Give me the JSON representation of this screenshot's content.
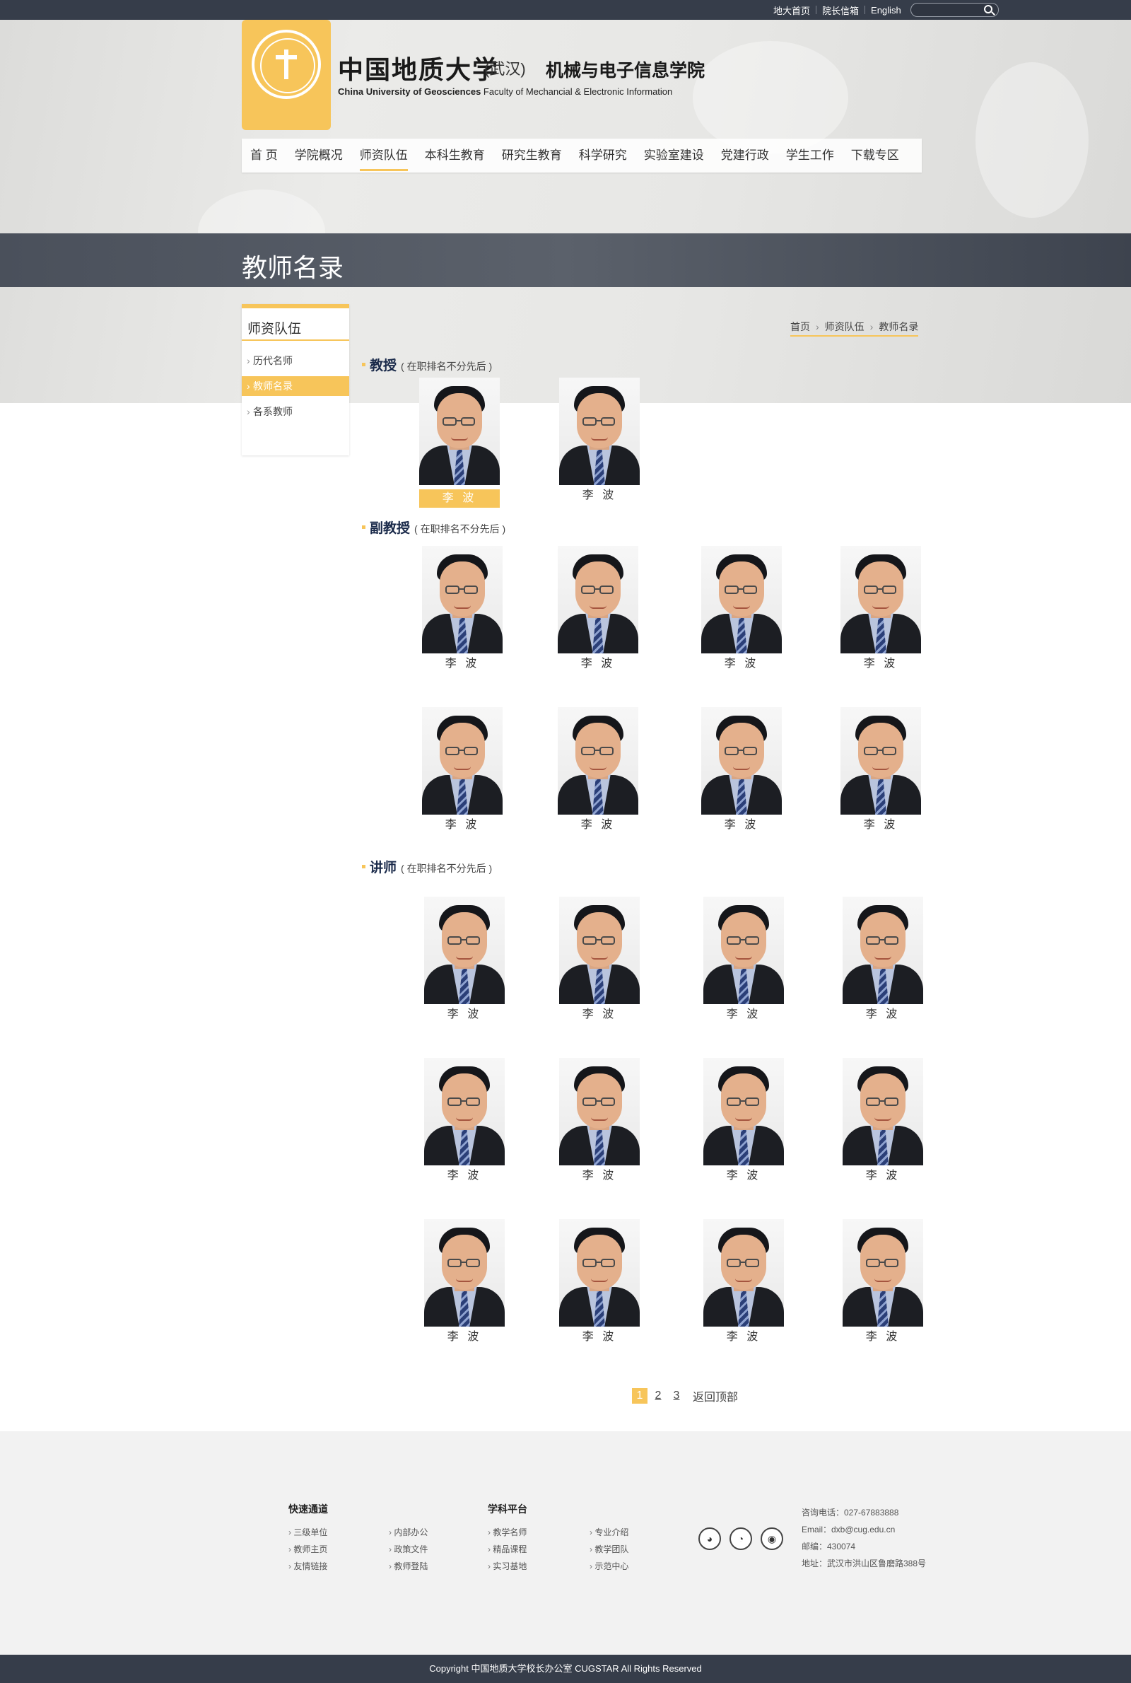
{
  "topbar": {
    "links": [
      "地大首页",
      "院长信箱",
      "English"
    ],
    "search_placeholder": ""
  },
  "brand": {
    "cn_name": "中国地质大学",
    "cn_campus": "(武汉)",
    "dept_cn": "机械与电子信息学院",
    "en_univ": "China University of Geosciences",
    "en_dept": "Faculty of Mechancial & Electronic Information"
  },
  "nav": [
    "首 页",
    "学院概况",
    "师资队伍",
    "本科生教育",
    "研究生教育",
    "科学研究",
    "实验室建设",
    "党建行政",
    "学生工作",
    "下载专区"
  ],
  "nav_active": "师资队伍",
  "banner_title": "教师名录",
  "sidebar": {
    "title": "师资队伍",
    "items": [
      "历代名师",
      "教师名录",
      "各系教师"
    ],
    "active": "教师名录"
  },
  "breadcrumb": [
    "首页",
    "师资队伍",
    "教师名录"
  ],
  "sections": {
    "professor": {
      "title": "教授",
      "note": "( 在职排名不分先后 )",
      "names": [
        "李 波",
        "李 波"
      ]
    },
    "associate": {
      "title": "副教授",
      "note": "( 在职排名不分先后 )",
      "names": [
        "李 波",
        "李 波",
        "李 波",
        "李 波",
        "李 波",
        "李 波",
        "李 波",
        "李 波"
      ]
    },
    "lecturer": {
      "title": "讲师",
      "note": "( 在职排名不分先后 )",
      "names": [
        "李 波",
        "李 波",
        "李 波",
        "李 波",
        "李 波",
        "李 波",
        "李 波",
        "李 波",
        "李 波",
        "李 波",
        "李 波",
        "李 波"
      ]
    }
  },
  "pager": {
    "pages": [
      "1",
      "2",
      "3"
    ],
    "current": "1",
    "back_top": "返回顶部"
  },
  "footer": {
    "quick": {
      "title": "快速通道",
      "col1": [
        "三级单位",
        "教师主页",
        "友情链接"
      ],
      "col2": [
        "内部办公",
        "政策文件",
        "教师登陆"
      ]
    },
    "platform": {
      "title": "学科平台",
      "col1": [
        "教学名师",
        "精品课程",
        "实习基地"
      ],
      "col2": [
        "专业介绍",
        "教学团队",
        "示范中心"
      ]
    },
    "social_icons": [
      "qq-icon",
      "wechat-icon",
      "weibo-icon"
    ],
    "contact": [
      "咨询电话：027-67883888",
      "Email：dxb@cug.edu.cn",
      "邮编：430074",
      "地址：武汉市洪山区鲁磨路388号"
    ],
    "copyright": "Copyright 中国地质大学校长办公室 CUGSTAR All Rights Reserved"
  },
  "colors": {
    "accent": "#f7c55a",
    "dark": "#363d4a"
  }
}
